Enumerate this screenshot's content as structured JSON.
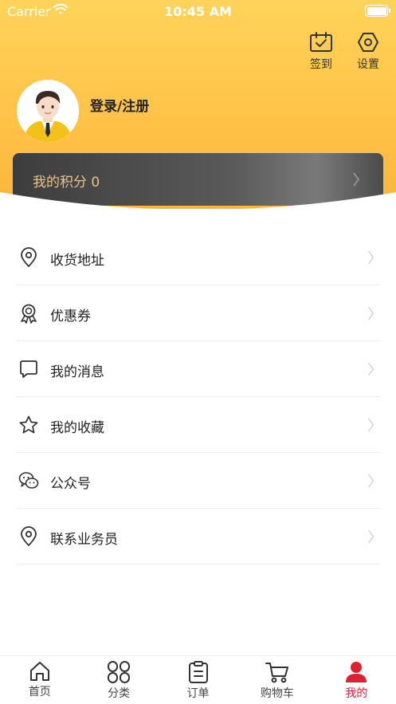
{
  "status_bar": {
    "carrier": "Carrier",
    "time": "10:45 AM"
  },
  "header": {
    "checkin_label": "签到",
    "settings_label": "设置",
    "login_label": "登录/注册"
  },
  "points": {
    "label": "我的积分 0"
  },
  "menu": {
    "items": [
      {
        "label": "收货地址",
        "icon": "location-pin-icon"
      },
      {
        "label": "优惠券",
        "icon": "badge-ribbon-icon"
      },
      {
        "label": "我的消息",
        "icon": "message-bubble-icon"
      },
      {
        "label": "我的收藏",
        "icon": "star-icon"
      },
      {
        "label": "公众号",
        "icon": "wechat-icon"
      },
      {
        "label": "联系业务员",
        "icon": "location-pin-icon"
      }
    ]
  },
  "tabbar": {
    "items": [
      {
        "label": "首页",
        "icon": "home-icon"
      },
      {
        "label": "分类",
        "icon": "category-icon"
      },
      {
        "label": "订单",
        "icon": "order-icon"
      },
      {
        "label": "购物车",
        "icon": "cart-icon"
      },
      {
        "label": "我的",
        "icon": "user-icon"
      }
    ],
    "active_index": 4
  },
  "colors": {
    "header_gradient_top": "#ffd35a",
    "header_gradient_bottom": "#fbb53c",
    "points_card": "#4b4b4b",
    "points_text": "#e8c48a",
    "active_tab": "#e02030"
  }
}
